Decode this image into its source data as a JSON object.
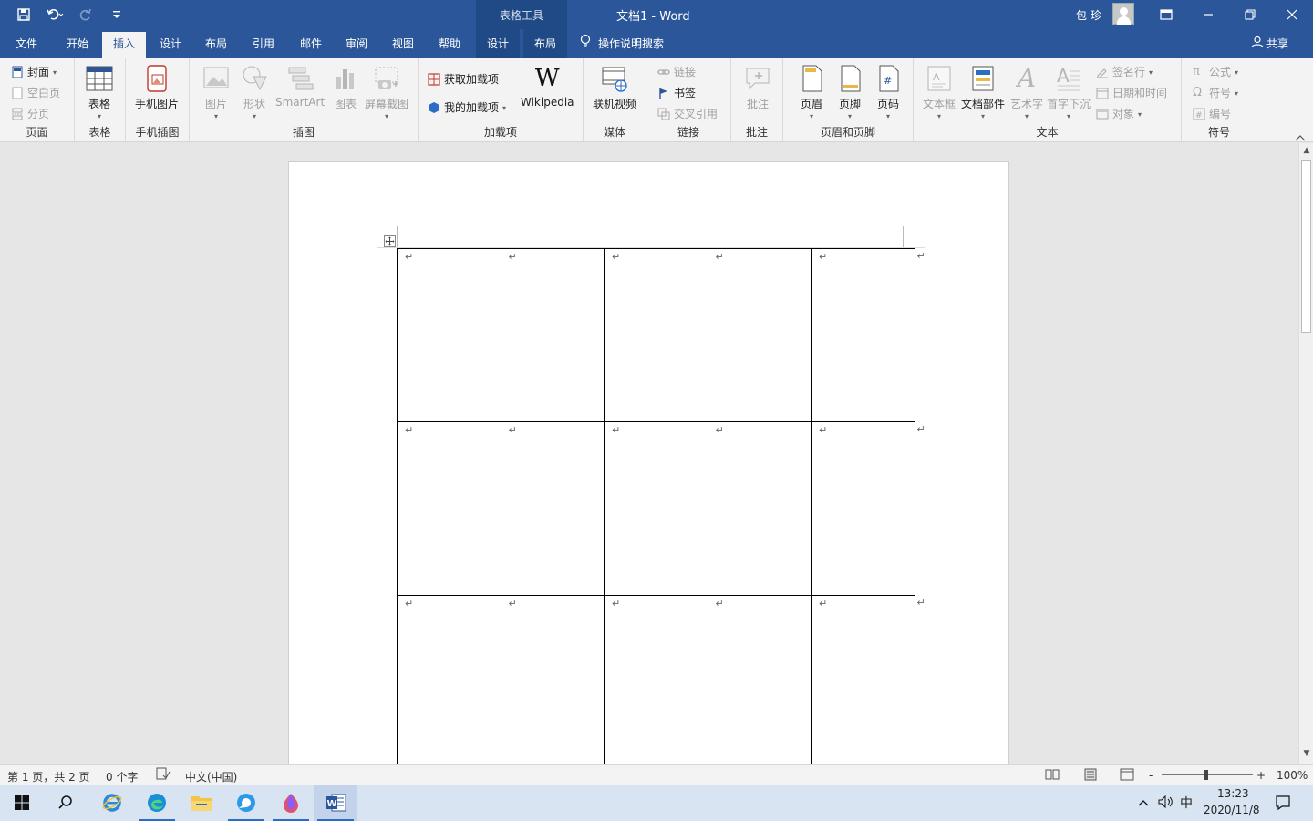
{
  "titlebar": {
    "context_label": "表格工具",
    "doc_title": "文档1  -  Word",
    "user_name": "包 珍"
  },
  "tabs": [
    {
      "label": "文件"
    },
    {
      "label": "开始"
    },
    {
      "label": "插入"
    },
    {
      "label": "设计"
    },
    {
      "label": "布局"
    },
    {
      "label": "引用"
    },
    {
      "label": "邮件"
    },
    {
      "label": "审阅"
    },
    {
      "label": "视图"
    },
    {
      "label": "帮助"
    },
    {
      "label": "设计"
    },
    {
      "label": "布局"
    }
  ],
  "active_tab": "插入",
  "search_label": "操作说明搜索",
  "share_label": "共享",
  "ribbon": {
    "pages": {
      "label": "页面",
      "cover": "封面",
      "blank": "空白页",
      "break": "分页"
    },
    "tables": {
      "label": "表格",
      "table": "表格"
    },
    "mobile": {
      "label": "手机插图",
      "photo": "手机图片"
    },
    "illustrations": {
      "label": "插图",
      "picture": "图片",
      "shapes": "形状",
      "smartart": "SmartArt",
      "chart": "图表",
      "screenshot": "屏幕截图"
    },
    "addins": {
      "label": "加载项",
      "get": "获取加载项",
      "mine": "我的加载项",
      "wikipedia": "Wikipedia"
    },
    "media": {
      "label": "媒体",
      "video": "联机视频"
    },
    "links": {
      "label": "链接",
      "link": "链接",
      "bookmark": "书签",
      "crossref": "交叉引用"
    },
    "comments": {
      "label": "批注",
      "comment": "批注"
    },
    "headerfooter": {
      "label": "页眉和页脚",
      "header": "页眉",
      "footer": "页脚",
      "pagenum": "页码"
    },
    "text": {
      "label": "文本",
      "textbox": "文本框",
      "parts": "文档部件",
      "wordart": "艺术字",
      "dropcap": "首字下沉",
      "signature": "签名行",
      "datetime": "日期和时间",
      "object": "对象"
    },
    "symbols": {
      "label": "符号",
      "equation": "公式",
      "symbol": "符号",
      "number": "编号"
    }
  },
  "document": {
    "paragraph_mark": "↵",
    "table": {
      "rows": 3,
      "cols": 5
    }
  },
  "statusbar": {
    "page": "第 1 页，共 2 页",
    "words": "0 个字",
    "language": "中文(中国)",
    "zoom_minus": "-",
    "zoom_plus": "+",
    "zoom": "100%"
  },
  "taskbar": {
    "ime": "中",
    "time": "13:23",
    "date": "2020/11/8"
  },
  "colors": {
    "word_blue": "#2b579a",
    "ribbon_bg": "#f3f3f3",
    "taskbar": "#d9e4f3"
  }
}
